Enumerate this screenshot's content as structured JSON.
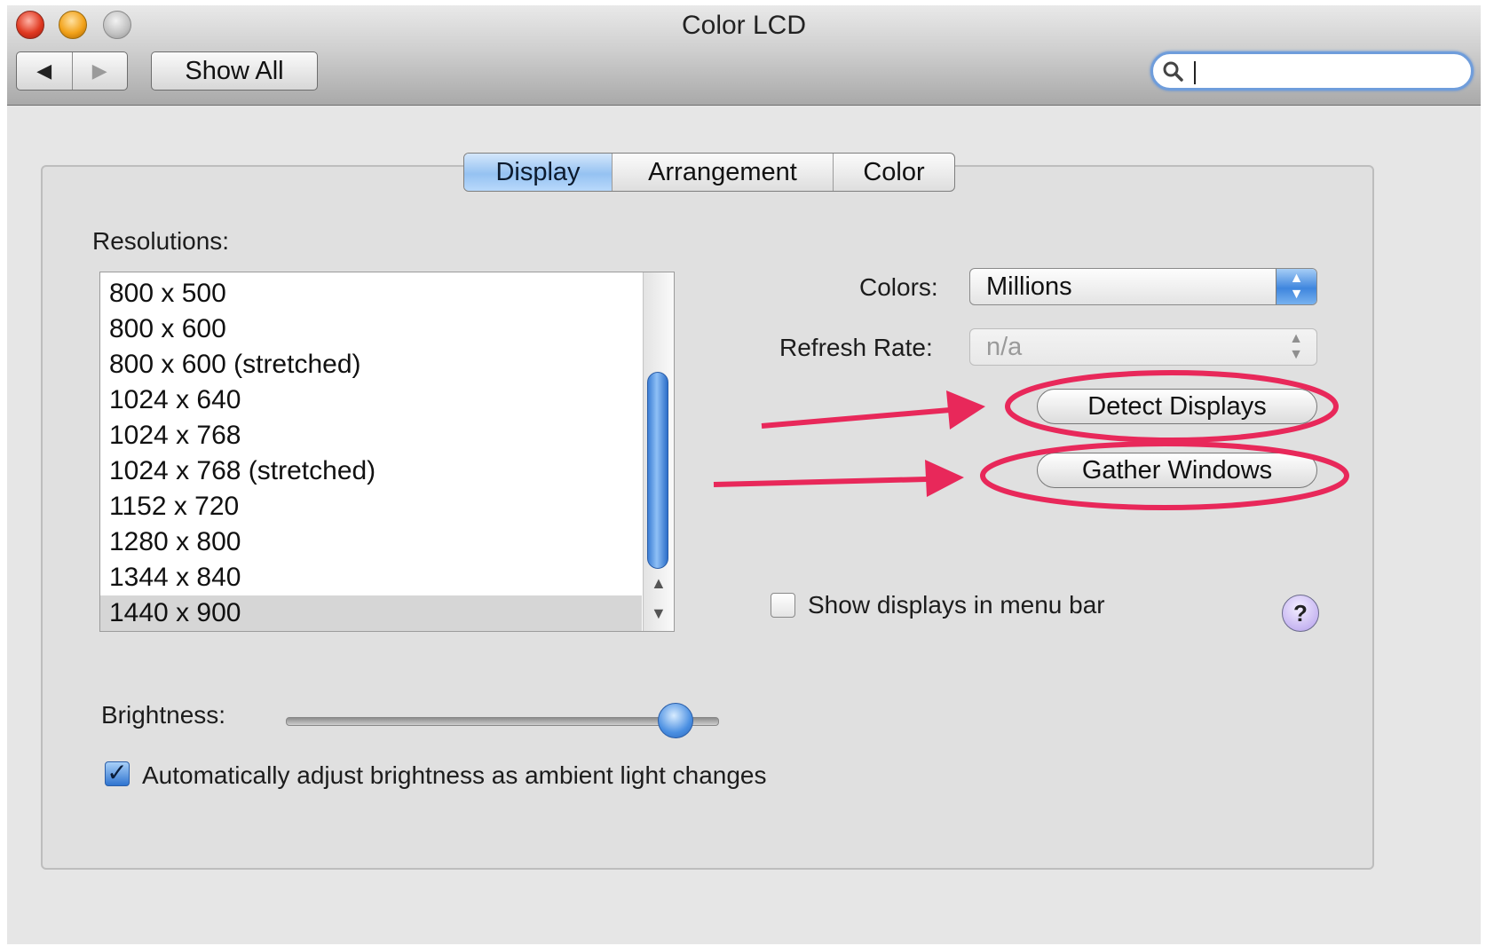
{
  "window": {
    "title": "Color LCD"
  },
  "toolbar": {
    "back_icon": "back-arrow-icon",
    "forward_icon": "forward-arrow-icon",
    "show_all_label": "Show All",
    "search_icon": "search-icon",
    "search_value": ""
  },
  "tabs": [
    {
      "label": "Display",
      "active": true
    },
    {
      "label": "Arrangement",
      "active": false
    },
    {
      "label": "Color",
      "active": false
    }
  ],
  "resolutions": {
    "label": "Resolutions:",
    "items": [
      "800 x 500",
      "800 x 600",
      "800 x 600 (stretched)",
      "1024 x 640",
      "1024 x 768",
      "1024 x 768 (stretched)",
      "1152 x 720",
      "1280 x 800",
      "1344 x 840",
      "1440 x 900"
    ],
    "selected": "1440 x 900"
  },
  "colors": {
    "label": "Colors:",
    "value": "Millions"
  },
  "refresh_rate": {
    "label": "Refresh Rate:",
    "value": "n/a",
    "enabled": false
  },
  "buttons": {
    "detect_displays": "Detect Displays",
    "gather_windows": "Gather Windows"
  },
  "show_in_menu_bar": {
    "label": "Show displays in menu bar",
    "checked": false
  },
  "help_label": "?",
  "brightness": {
    "label": "Brightness:",
    "level": 0.9
  },
  "auto_brightness": {
    "label": "Automatically adjust brightness as ambient light changes",
    "checked": true
  },
  "annotation_color": "#e8285a",
  "accent_color": "#3f86de"
}
